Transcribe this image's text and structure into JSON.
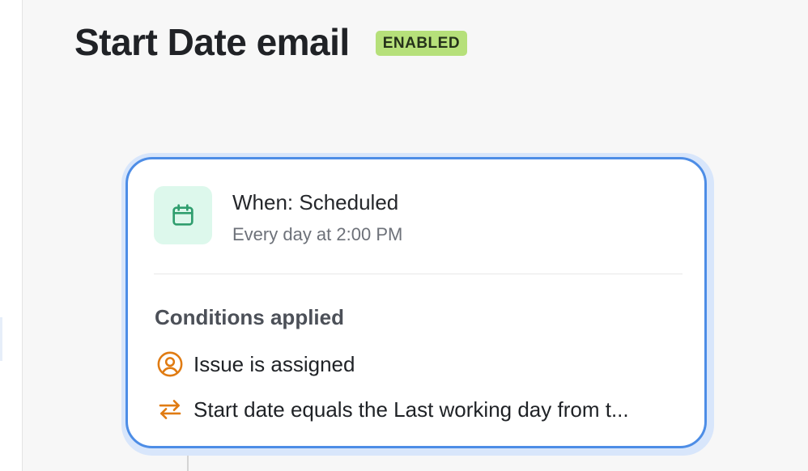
{
  "header": {
    "title": "Start Date email",
    "status_badge": "ENABLED",
    "badge_color": "#b6e07a"
  },
  "trigger": {
    "icon": "calendar-icon",
    "title": "When: Scheduled",
    "schedule": "Every day at 2:00 PM",
    "icon_color": "#2f9e6e",
    "tile_color": "#ddf8ec"
  },
  "conditions": {
    "heading": "Conditions applied",
    "items": [
      {
        "icon": "user-circle-icon",
        "label": "Issue is assigned"
      },
      {
        "icon": "swap-arrows-icon",
        "label": "Start date equals the Last working day from t..."
      }
    ],
    "icon_color": "#e07b12"
  },
  "colors": {
    "card_border": "#4d8de6",
    "card_halo": "#d8e6fb",
    "background": "#f7f7f7"
  }
}
